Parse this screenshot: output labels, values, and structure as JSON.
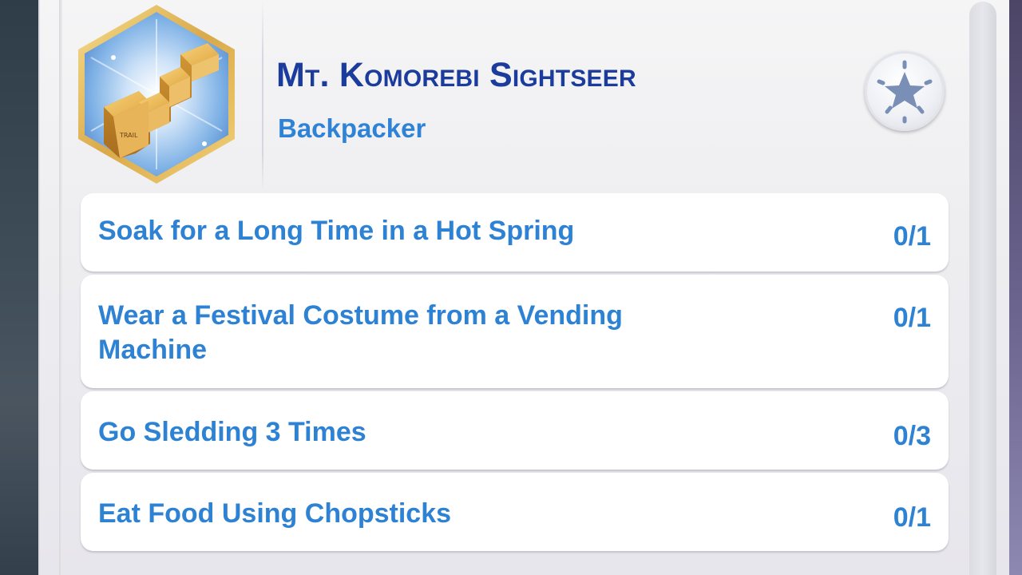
{
  "aspiration": {
    "title": "Mt. Komorebi Sightseer",
    "subtitle": "Backpacker",
    "badge_icon": "golden-stairs-icon",
    "action_icon": "star-burst-icon"
  },
  "tasks": [
    {
      "label": "Soak for a Long Time in a Hot Spring",
      "progress": "0/1"
    },
    {
      "label": "Wear a Festival Costume from a Vending Machine",
      "progress": "0/1"
    },
    {
      "label": "Go Sledding 3 Times",
      "progress": "0/3"
    },
    {
      "label": "Eat Food Using Chopsticks",
      "progress": "0/1"
    }
  ],
  "colors": {
    "title": "#1b3c9c",
    "text": "#2e82d4",
    "badge_border": "#e9c46a",
    "badge_fill": "#7fb2e6",
    "star": "#7a8fb6"
  }
}
